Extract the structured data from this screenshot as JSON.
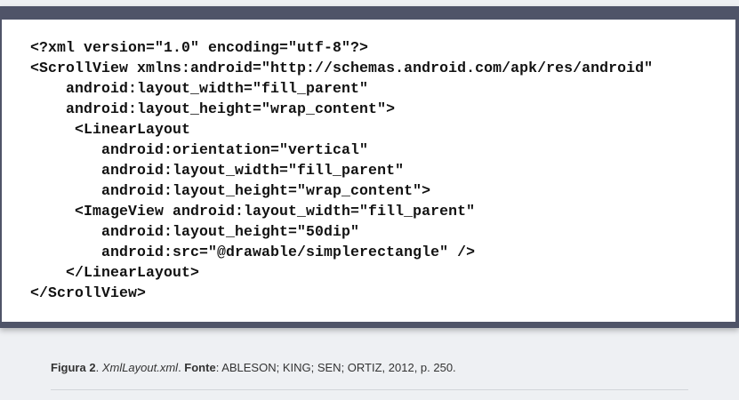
{
  "code": {
    "lines": [
      "<?xml version=\"1.0\" encoding=\"utf-8\"?>",
      "<ScrollView xmlns:android=\"http://schemas.android.com/apk/res/android\"",
      "    android:layout_width=\"fill_parent\"",
      "    android:layout_height=\"wrap_content\">",
      "     <LinearLayout",
      "        android:orientation=\"vertical\"",
      "        android:layout_width=\"fill_parent\"",
      "        android:layout_height=\"wrap_content\">",
      "     <ImageView android:layout_width=\"fill_parent\"",
      "        android:layout_height=\"50dip\"",
      "        android:src=\"@drawable/simplerectangle\" />",
      "    </LinearLayout>",
      "</ScrollView>"
    ]
  },
  "caption": {
    "label": "Figura 2",
    "sep1": ". ",
    "filename": "XmlLayout.xml",
    "sep2": ". ",
    "source_label": "Fonte",
    "source_text": ": ABLESON; KING; SEN; ORTIZ, 2012, p. 250."
  }
}
